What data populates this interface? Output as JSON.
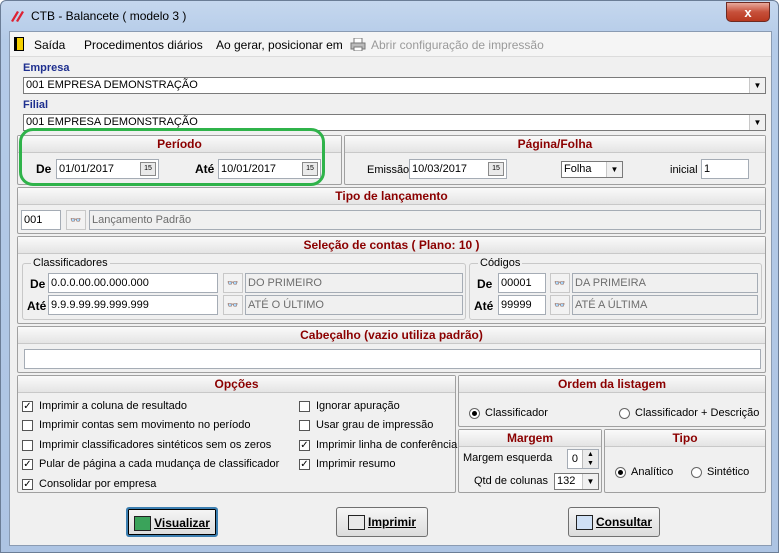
{
  "window": {
    "title": "CTB - Balancete ( modelo 3 )",
    "close_glyph": "x"
  },
  "menu": {
    "exit": "Saída",
    "daily": "Procedimentos diários",
    "on_generate": "Ao gerar, posicionar em",
    "print_config": "Abrir configuração de impressão"
  },
  "empresa": {
    "label": "Empresa",
    "value": "001 EMPRESA DEMONSTRAÇÃO"
  },
  "filial": {
    "label": "Filial",
    "value": "001 EMPRESA DEMONSTRAÇÃO"
  },
  "periodo": {
    "title": "Período",
    "de_label": "De",
    "de_value": "01/01/2017",
    "ate_label": "Até",
    "ate_value": "10/01/2017"
  },
  "pagina": {
    "title": "Página/Folha",
    "emissao_label": "Emissão",
    "emissao_value": "10/03/2017",
    "folha_value": "Folha",
    "inicial_label": "inicial",
    "inicial_value": "1"
  },
  "tipo_lancamento": {
    "title": "Tipo de lançamento",
    "code": "001",
    "desc": "Lançamento Padrão"
  },
  "contas": {
    "title": "Seleção de contas  ( Plano: 10 )",
    "classificadores": {
      "legend": "Classificadores",
      "de_label": "De",
      "de_value": "0.0.0.00.00.000.000",
      "de_desc": "DO PRIMEIRO",
      "ate_label": "Até",
      "ate_value": "9.9.9.99.99.999.999",
      "ate_desc": "ATÉ O ÚLTIMO"
    },
    "codigos": {
      "legend": "Códigos",
      "de_label": "De",
      "de_value": "00001",
      "de_desc": "DA PRIMEIRA",
      "ate_label": "Até",
      "ate_value": "99999",
      "ate_desc": "ATÉ A ÚLTIMA"
    }
  },
  "cabecalho": {
    "title": "Cabeçalho (vazio utiliza padrão)",
    "value": ""
  },
  "opcoes": {
    "title": "Opções",
    "items": [
      {
        "label": "Imprimir a coluna de resultado",
        "checked": true
      },
      {
        "label": "Imprimir contas sem movimento no período",
        "checked": false
      },
      {
        "label": "Imprimir classificadores sintéticos sem os zeros",
        "checked": false
      },
      {
        "label": "Pular de página a cada mudança de classificador",
        "checked": true
      },
      {
        "label": "Consolidar por empresa",
        "checked": true
      },
      {
        "label": "Ignorar apuração",
        "checked": false
      },
      {
        "label": "Usar grau de impressão",
        "checked": false
      },
      {
        "label": "Imprimir linha de conferência",
        "checked": true
      },
      {
        "label": "Imprimir resumo",
        "checked": true
      }
    ]
  },
  "ordem": {
    "title": "Ordem da listagem",
    "opt1": "Classificador",
    "opt2": "Classificador + Descrição",
    "selected": "Classificador"
  },
  "margem": {
    "title": "Margem",
    "esquerda_label": "Margem esquerda",
    "esquerda_value": "0",
    "colunas_label": "Qtd de colunas",
    "colunas_value": "132"
  },
  "tipo": {
    "title": "Tipo",
    "opt1": "Analítico",
    "opt2": "Sintético",
    "selected": "Analítico"
  },
  "buttons": {
    "visualizar": "Visualizar",
    "imprimir": "Imprimir",
    "consultar": "Consultar"
  },
  "colors": {
    "section_title": "#8b0000",
    "label_blue": "#1e2f8f",
    "highlight": "#2fb34a"
  }
}
